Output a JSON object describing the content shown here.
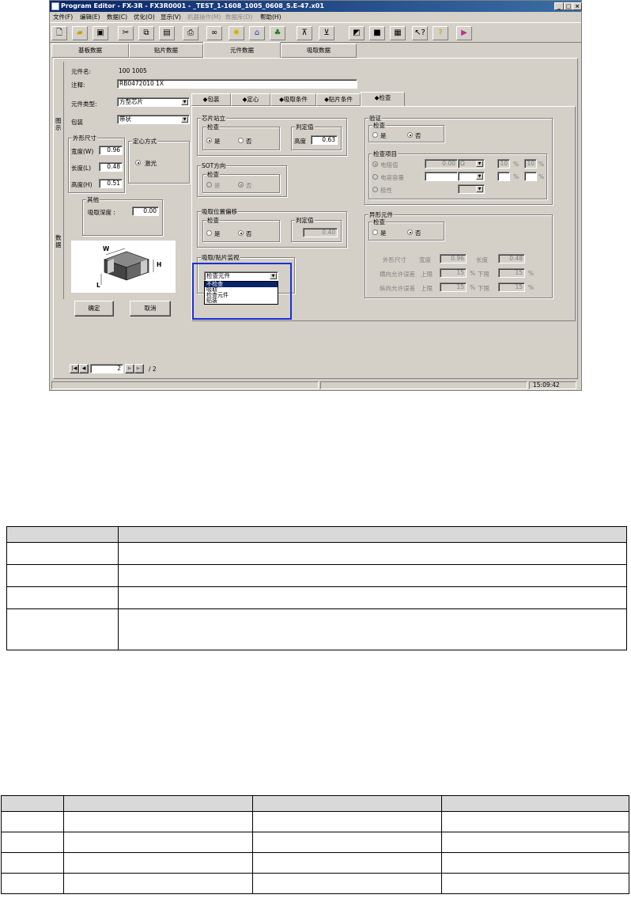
{
  "window": {
    "title": "Program Editor - FX-3R - FX3R0001 - _TEST_1-1608_1005_0608_S.E-47.x01",
    "menus": [
      {
        "label": "文件(F)",
        "enabled": true
      },
      {
        "label": "编辑(E)",
        "enabled": true
      },
      {
        "label": "数据(C)",
        "enabled": true
      },
      {
        "label": "优化(O)",
        "enabled": true
      },
      {
        "label": "显示(V)",
        "enabled": true
      },
      {
        "label": "机器操作(M)",
        "enabled": false
      },
      {
        "label": "数据库(D)",
        "enabled": false
      },
      {
        "label": "帮助(H)",
        "enabled": true
      }
    ],
    "toolbar_icons": [
      "new-icon",
      "open-icon",
      "save-icon",
      "cut-icon",
      "copy-icon",
      "paste-icon",
      "print-icon",
      "binoculars-icon",
      "bulb-icon",
      "machine-icon",
      "component-icon",
      "align-top-icon",
      "align-bottom-icon",
      "move-icon",
      "stop-icon",
      "grid-icon",
      "context-help-icon",
      "help-icon",
      "exit-icon"
    ],
    "main_tabs": [
      "基板数据",
      "贴片数据",
      "元件数据",
      "吸取数据"
    ],
    "active_main_tab": "元件数据",
    "side_tabs": [
      "图示",
      "数据"
    ],
    "status_time": "15:09:42"
  },
  "component": {
    "name_label": "元件名:",
    "name_value": "100 1005",
    "comment_label": "注释:",
    "comment_value": "RB0472010 1X",
    "type_label": "元件类型:",
    "type_value": "方型芯片",
    "package_label": "包装",
    "package_value": "带状",
    "outer_size": {
      "title": "外形尺寸",
      "width_label": "宽度(W)",
      "width_value": "0.96",
      "length_label": "长度(L)",
      "length_value": "0.48",
      "height_label": "高度(H)",
      "height_value": "0.51"
    },
    "centering": {
      "title": "定心方式",
      "option": "激光"
    },
    "other": {
      "title": "其他",
      "depth_label": "吸取深度 :",
      "depth_value": "0.00"
    },
    "ok_label": "确定",
    "cancel_label": "取消",
    "nav": {
      "page": "2",
      "total": "/ 2"
    }
  },
  "sub_tabs": [
    "◆包装",
    "◆定心",
    "◆吸取条件",
    "◆贴片条件",
    "◆检查"
  ],
  "active_sub_tab": "◆检查",
  "check": {
    "standing": {
      "title": "芯片站立",
      "check_title": "检查",
      "yes": "是",
      "no": "否",
      "selected": "是",
      "judge_title": "判定值",
      "height_label": "高度",
      "height_value": "0.63"
    },
    "sot": {
      "title": "SOT方向",
      "check_title": "检查",
      "yes": "是",
      "no": "否",
      "selected": "否"
    },
    "pick_offset": {
      "title": "吸取位置偏移",
      "check_title": "检查",
      "yes": "是",
      "no": "否",
      "selected": "否",
      "judge_title": "判定值",
      "value": "0.40"
    },
    "monitor": {
      "title": "吸取/贴片监视",
      "selected": "检查元件",
      "options": [
        "不检查",
        "吸取",
        "检查元件",
        "贴装"
      ],
      "highlighted": "不检查"
    },
    "verify": {
      "title": "验证",
      "check_title": "检查",
      "yes": "是",
      "no": "否",
      "selected": "否",
      "items_title": "检查项目",
      "rows": [
        {
          "label": "电阻值",
          "value": "0.00",
          "unit": "Ω",
          "tol1": "10",
          "tol2": "10"
        },
        {
          "label": "电容容量",
          "value": "",
          "unit": "",
          "tol1": "",
          "tol2": ""
        },
        {
          "label": "极性",
          "value": "",
          "unit": "",
          "tol1": "",
          "tol2": ""
        }
      ],
      "pct": "%"
    },
    "odd_part": {
      "title": "异形元件",
      "check_title": "检查",
      "yes": "是",
      "no": "否",
      "selected": "否",
      "size_label": "外形尺寸",
      "width_label": "宽度",
      "width_value": "0.96",
      "length_label": "长度",
      "length_value": "0.48",
      "horiz_label": "横向允许误差",
      "vert_label": "纵向允许误差",
      "upper_label": "上限",
      "lower_label": "下限",
      "horiz_upper": "15",
      "horiz_lower": "15",
      "vert_upper": "15",
      "vert_lower": "15",
      "pct": "%"
    }
  },
  "diagram": {
    "w": "W",
    "h": "H",
    "l": "L"
  }
}
